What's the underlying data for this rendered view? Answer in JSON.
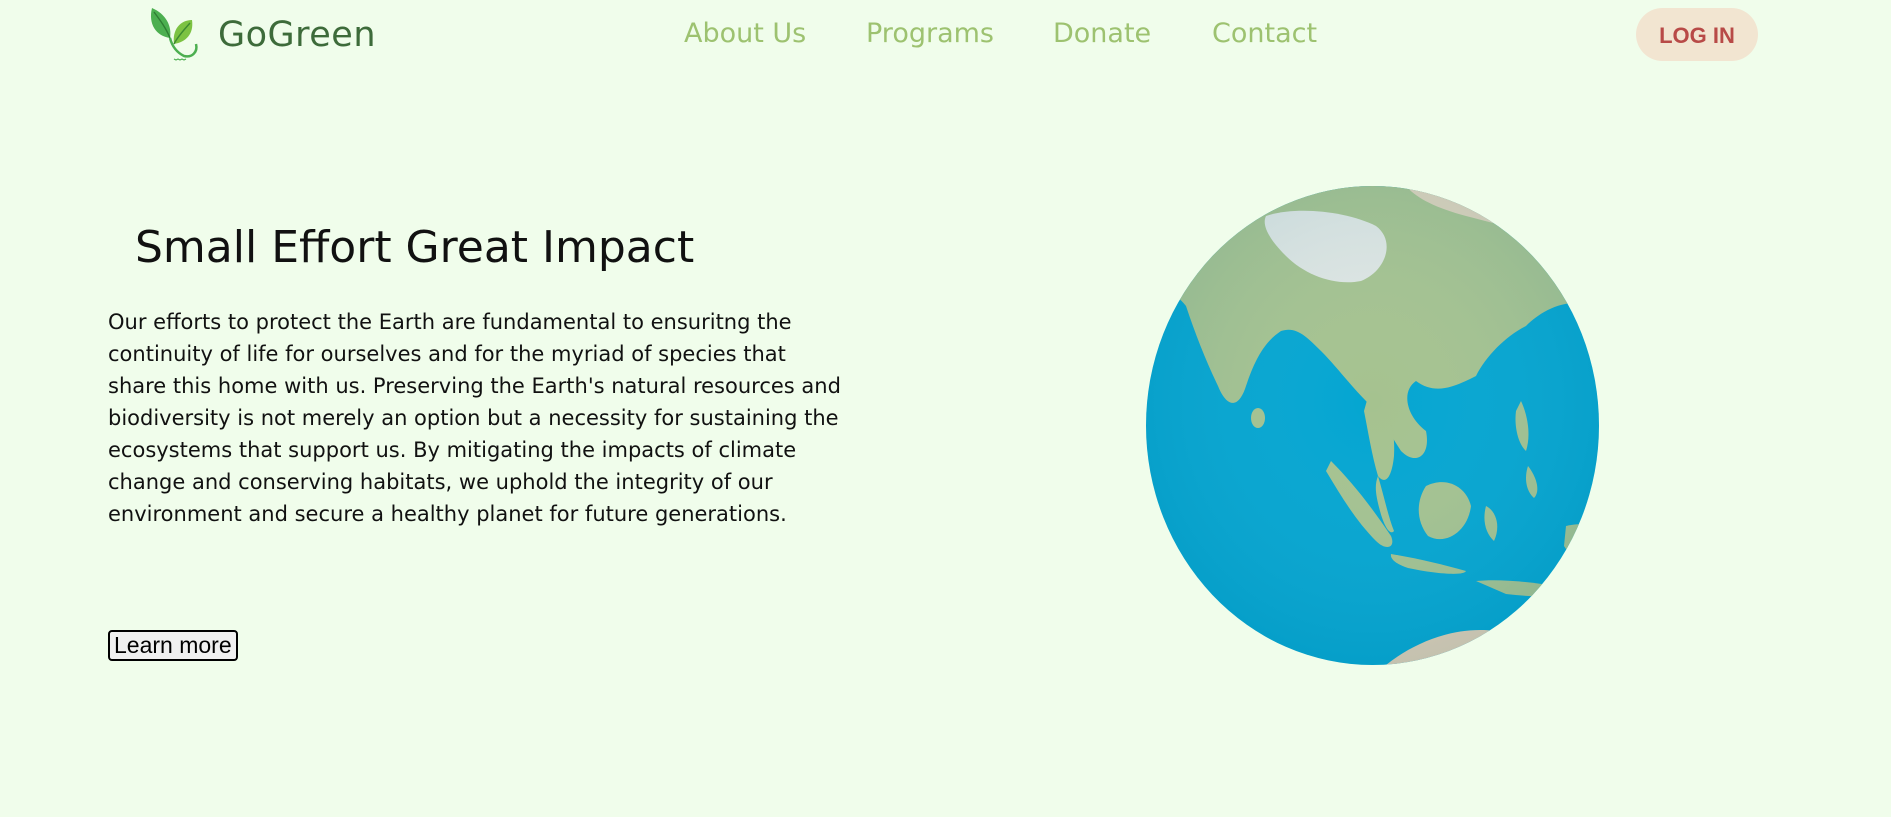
{
  "header": {
    "brand": "GoGreen",
    "logo_icon": "leaf-logo-icon",
    "nav": [
      {
        "label": "About Us"
      },
      {
        "label": "Programs"
      },
      {
        "label": "Donate"
      },
      {
        "label": "Contact"
      }
    ],
    "login_label": "LOG IN"
  },
  "hero": {
    "title": "Small Effort Great Impact",
    "body": "Our efforts to protect the Earth are fundamental to ensuritng the continuity of life for ourselves and for the myriad of species that share this home with us. Preserving the Earth's natural resources and biodiversity is not merely an option but a necessity for sustaining the ecosystems that support us. By mitigating the impacts of climate change and conserving habitats, we uphold the integrity of our environment and secure a healthy planet for future generations.",
    "cta_label": "Learn more",
    "image": "earth-globe-image"
  },
  "colors": {
    "background": "#f0fdeb",
    "brand_text": "#3d6b3a",
    "nav_text": "#9dc270",
    "login_bg": "#f2e5d1",
    "login_text": "#b84a47",
    "ocean": "#03a5d1",
    "land": "#a5c28f"
  }
}
